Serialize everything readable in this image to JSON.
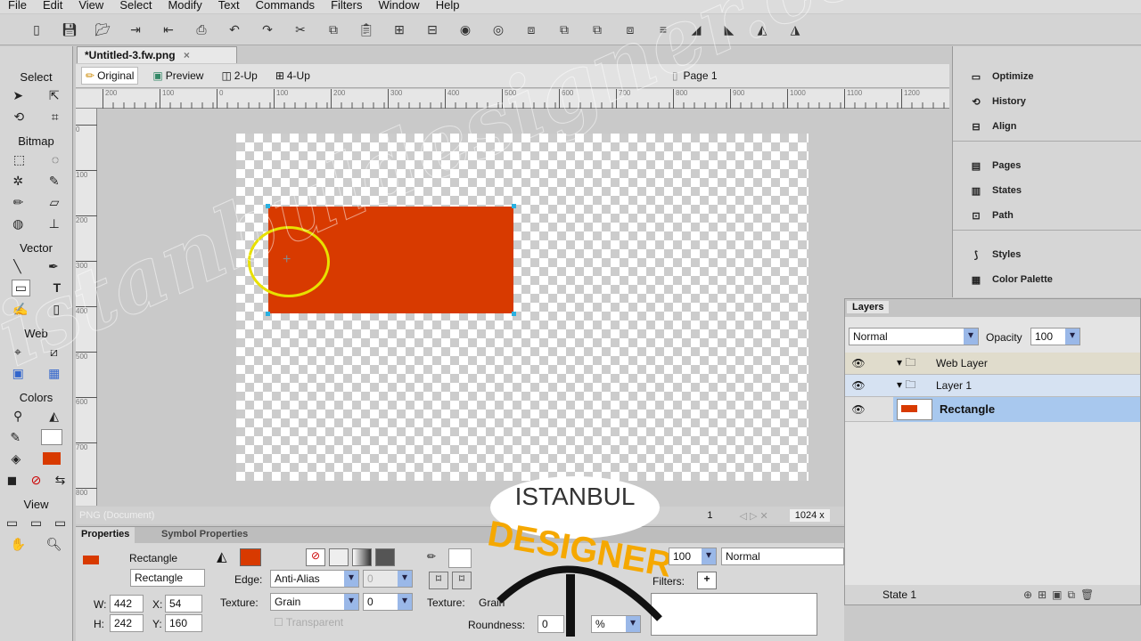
{
  "menu": [
    "File",
    "Edit",
    "View",
    "Select",
    "Modify",
    "Text",
    "Commands",
    "Filters",
    "Window",
    "Help"
  ],
  "toolbar_icons": [
    "new-icon",
    "save-icon",
    "open-icon",
    "import-icon",
    "export-icon",
    "print-icon",
    "undo-icon",
    "redo-icon",
    "cut-icon",
    "copy-icon",
    "paste-icon",
    "group-icon",
    "ungroup-icon",
    "join-icon",
    "split-icon",
    "bring-front-icon",
    "bring-forward-icon",
    "send-backward-icon",
    "send-back-icon",
    "align-icon",
    "rotate-left-icon",
    "rotate-right-icon",
    "flip-h-icon",
    "flip-v-icon"
  ],
  "tools": {
    "select": "Select",
    "bitmap": "Bitmap",
    "vector": "Vector",
    "web": "Web",
    "colors": "Colors",
    "view": "View"
  },
  "document": {
    "tab": "*Untitled-3.fw.png",
    "close": "×",
    "views": [
      "Original",
      "Preview",
      "2-Up",
      "4-Up"
    ],
    "page": "Page 1",
    "hruler": [
      "200",
      "100",
      "0",
      "100",
      "200",
      "300",
      "400",
      "500",
      "600",
      "700",
      "800",
      "900",
      "1000",
      "1100",
      "1200"
    ],
    "vruler": [
      "0",
      "100",
      "200",
      "300",
      "400",
      "500",
      "600",
      "700",
      "800"
    ]
  },
  "status": {
    "doc": "PNG (Document)",
    "frame": "1",
    "size": "1024 x"
  },
  "properties": {
    "tab1": "Properties",
    "tab2": "Symbol Properties",
    "type": "Rectangle",
    "name": "Rectangle",
    "w": "442",
    "h": "242",
    "x": "54",
    "y": "160",
    "fill_color": "#d83a00",
    "edge_label": "Edge:",
    "edge": "Anti-Alias",
    "edge_val": "0",
    "texture_label": "Texture:",
    "texture": "Grain",
    "texture_val": "0",
    "transparent": "Transparent",
    "stroke_texture_label": "Texture:",
    "stroke_texture": "Grain",
    "roundness_label": "Roundness:",
    "roundness": "0",
    "roundness_unit": "%",
    "opacity": "100",
    "blend": "Normal",
    "filters_label": "Filters:"
  },
  "right_panel": [
    [
      "optimize-icon",
      "Optimize"
    ],
    [
      "history-icon",
      "History"
    ],
    [
      "align-icon",
      "Align"
    ],
    [
      "pages-icon",
      "Pages"
    ],
    [
      "states-icon",
      "States"
    ],
    [
      "path-icon",
      "Path"
    ],
    [
      "styles-icon",
      "Styles"
    ],
    [
      "color-palette-icon",
      "Color Palette"
    ]
  ],
  "layers": {
    "title": "Layers",
    "blend": "Normal",
    "opacity_label": "Opacity",
    "opacity": "100",
    "rows": [
      "Web Layer",
      "Layer 1",
      "Rectangle"
    ],
    "state": "State 1"
  },
  "watermark": "istanbuldesigner.com",
  "logo": {
    "line1": "ISTANBUL",
    "line2": "DESIGNER"
  }
}
